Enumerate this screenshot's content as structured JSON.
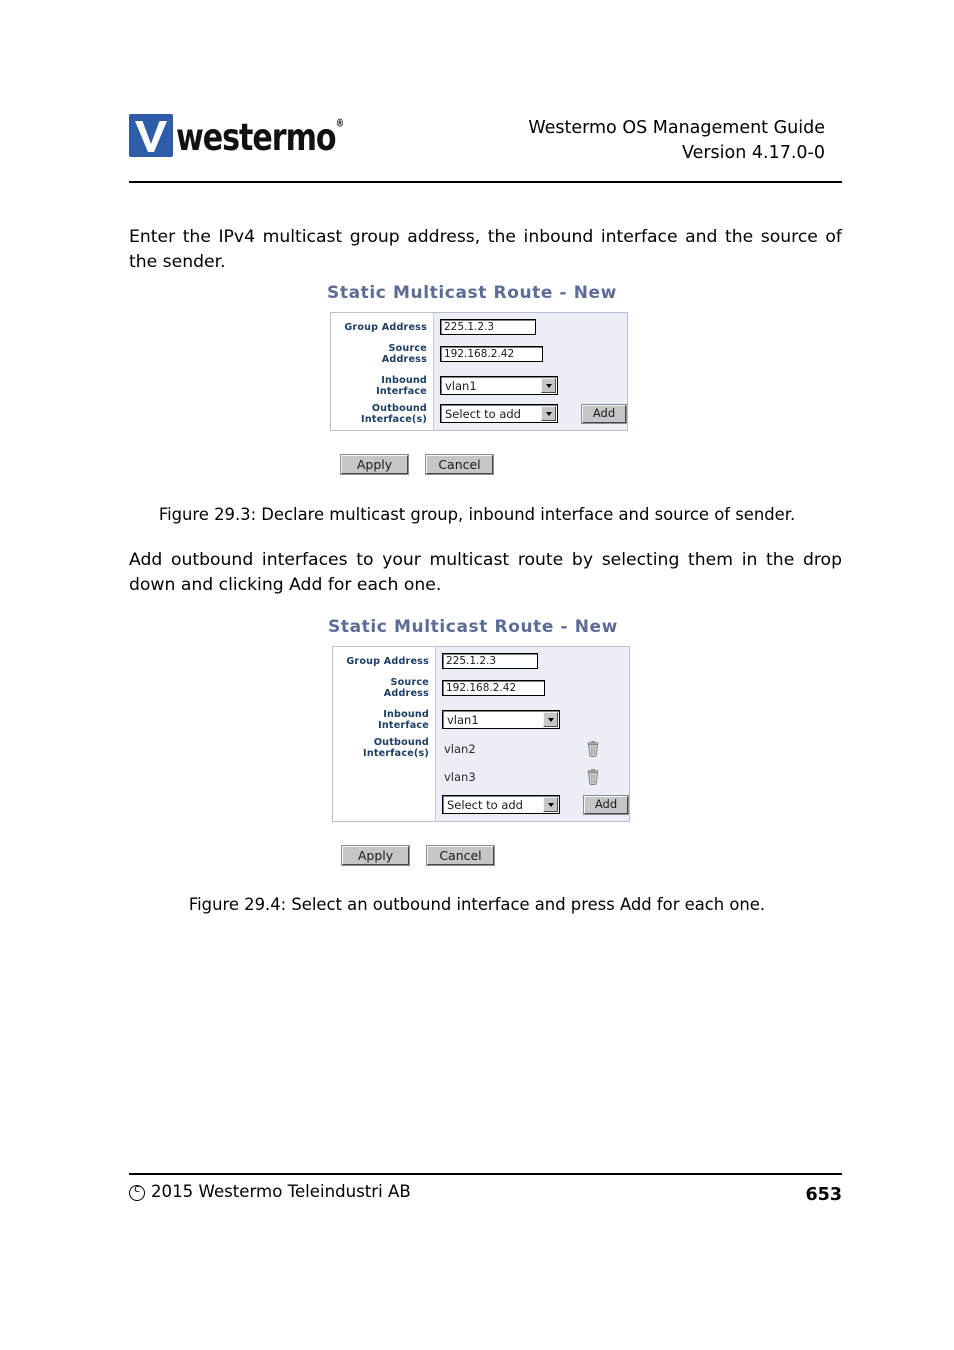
{
  "header": {
    "logo_text": "westermo",
    "logo_registered": "®",
    "logo_icon": "westermo-w-logo",
    "title_line1": "Westermo OS Management Guide",
    "title_line2": "Version 4.17.0-0"
  },
  "body": {
    "paragraph1": "Enter the IPv4 multicast group address, the inbound interface and the source of the sender.",
    "paragraph2": "Add outbound interfaces to your multicast route by selecting them in the drop down and clicking Add for each one.",
    "caption1": "Figure 29.3: Declare multicast group, inbound interface and source of sender.",
    "caption2": "Figure 29.4: Select an outbound interface and press Add for each one."
  },
  "figure1": {
    "title": "Static Multicast Route - New",
    "labels": {
      "group_address": "Group Address",
      "source_address_line1": "Source",
      "source_address_line2": "Address",
      "inbound_line1": "Inbound",
      "inbound_line2": "Interface",
      "outbound_line1": "Outbound",
      "outbound_line2": "Interface(s)"
    },
    "fields": {
      "group_address_value": "225.1.2.3",
      "source_address_value": "192.168.2.42",
      "inbound_interface_value": "vlan1",
      "outbound_select_value": "Select to add"
    },
    "buttons": {
      "add": "Add",
      "apply": "Apply",
      "cancel": "Cancel"
    }
  },
  "figure2": {
    "title": "Static Multicast Route - New",
    "labels": {
      "group_address": "Group Address",
      "source_address_line1": "Source",
      "source_address_line2": "Address",
      "inbound_line1": "Inbound",
      "inbound_line2": "Interface",
      "outbound_line1": "Outbound",
      "outbound_line2": "Interface(s)"
    },
    "fields": {
      "group_address_value": "225.1.2.3",
      "source_address_value": "192.168.2.42",
      "inbound_interface_value": "vlan1",
      "outbound_select_value": "Select to add"
    },
    "outbound_interfaces": [
      {
        "name": "vlan2",
        "delete_icon": "trash-icon"
      },
      {
        "name": "vlan3",
        "delete_icon": "trash-icon"
      }
    ],
    "buttons": {
      "add": "Add",
      "apply": "Apply",
      "cancel": "Cancel"
    }
  },
  "footer": {
    "copyright": "2015 Westermo Teleindustri AB",
    "copyright_symbol": "copyright-icon",
    "page_number": "653"
  },
  "colors": {
    "logo_blue": "#2d5ca8",
    "widget_title_blue": "#5c6c96",
    "widget_label_blue": "#1b3e63",
    "panel_background": "#eceef6",
    "button_face": "#c6c6c6"
  }
}
